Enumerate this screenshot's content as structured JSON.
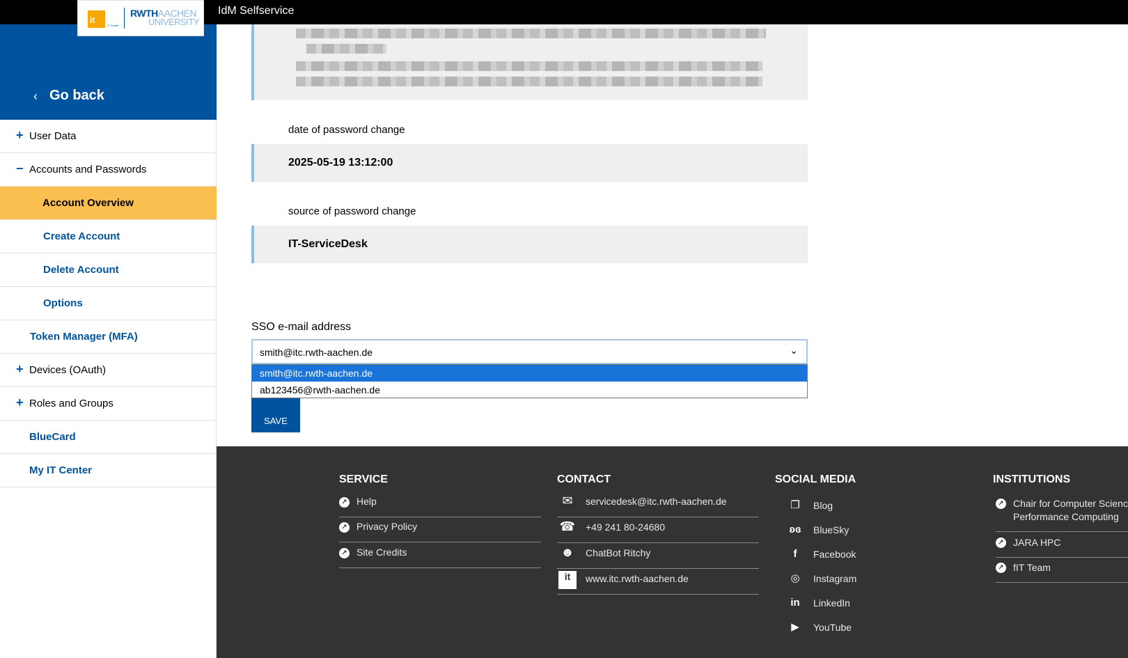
{
  "header": {
    "app_title": "IdM Selfservice"
  },
  "logo": {
    "it_text": "it",
    "it_sub": "IT Center",
    "rwth": "RWTH",
    "aachen": "AACHEN",
    "university": "UNIVERSITY"
  },
  "sidebar": {
    "go_back": "Go back",
    "items": [
      {
        "label": "User Data",
        "symbol": "+"
      },
      {
        "label": "Accounts and Passwords",
        "symbol": "−"
      },
      {
        "label": "Account Overview"
      },
      {
        "label": "Create Account"
      },
      {
        "label": "Delete Account"
      },
      {
        "label": "Options"
      },
      {
        "label": "Token Manager (MFA)"
      },
      {
        "label": "Devices (OAuth)",
        "symbol": "+"
      },
      {
        "label": "Roles and Groups",
        "symbol": "+"
      },
      {
        "label": "BlueCard"
      },
      {
        "label": "My IT Center"
      }
    ]
  },
  "main": {
    "password_change_date_label": "date of password change",
    "password_change_date_value": "2025-05-19 13:12:00",
    "password_change_source_label": "source of password change",
    "password_change_source_value": "IT-ServiceDesk",
    "sso_label": "SSO e-mail address",
    "sso_selected": "smith@itc.rwth-aachen.de",
    "sso_options": [
      "smith@itc.rwth-aachen.de",
      "ab123456@rwth-aachen.de"
    ],
    "save_label": "SAVE"
  },
  "footer": {
    "service": {
      "heading": "SERVICE",
      "links": [
        "Help",
        "Privacy Policy",
        "Site Credits"
      ]
    },
    "contact": {
      "heading": "CONTACT",
      "links": [
        "servicedesk@itc.rwth-aachen.de",
        "+49 241 80-24680",
        "ChatBot Ritchy",
        "www.itc.rwth-aachen.de"
      ]
    },
    "social": {
      "heading": "SOCIAL MEDIA",
      "links": [
        "Blog",
        "BlueSky",
        "Facebook",
        "Instagram",
        "LinkedIn",
        "YouTube"
      ]
    },
    "institutions": {
      "heading": "INSTITUTIONS",
      "links": [
        "Chair for Computer Science",
        "Performance Computing",
        "JARA HPC",
        "fIT Team"
      ]
    }
  },
  "colors": {
    "brand_blue": "#00549f",
    "active_yellow": "#fbbe51",
    "footer_bg": "#333333",
    "dropdown_highlight": "#1a73d9"
  }
}
